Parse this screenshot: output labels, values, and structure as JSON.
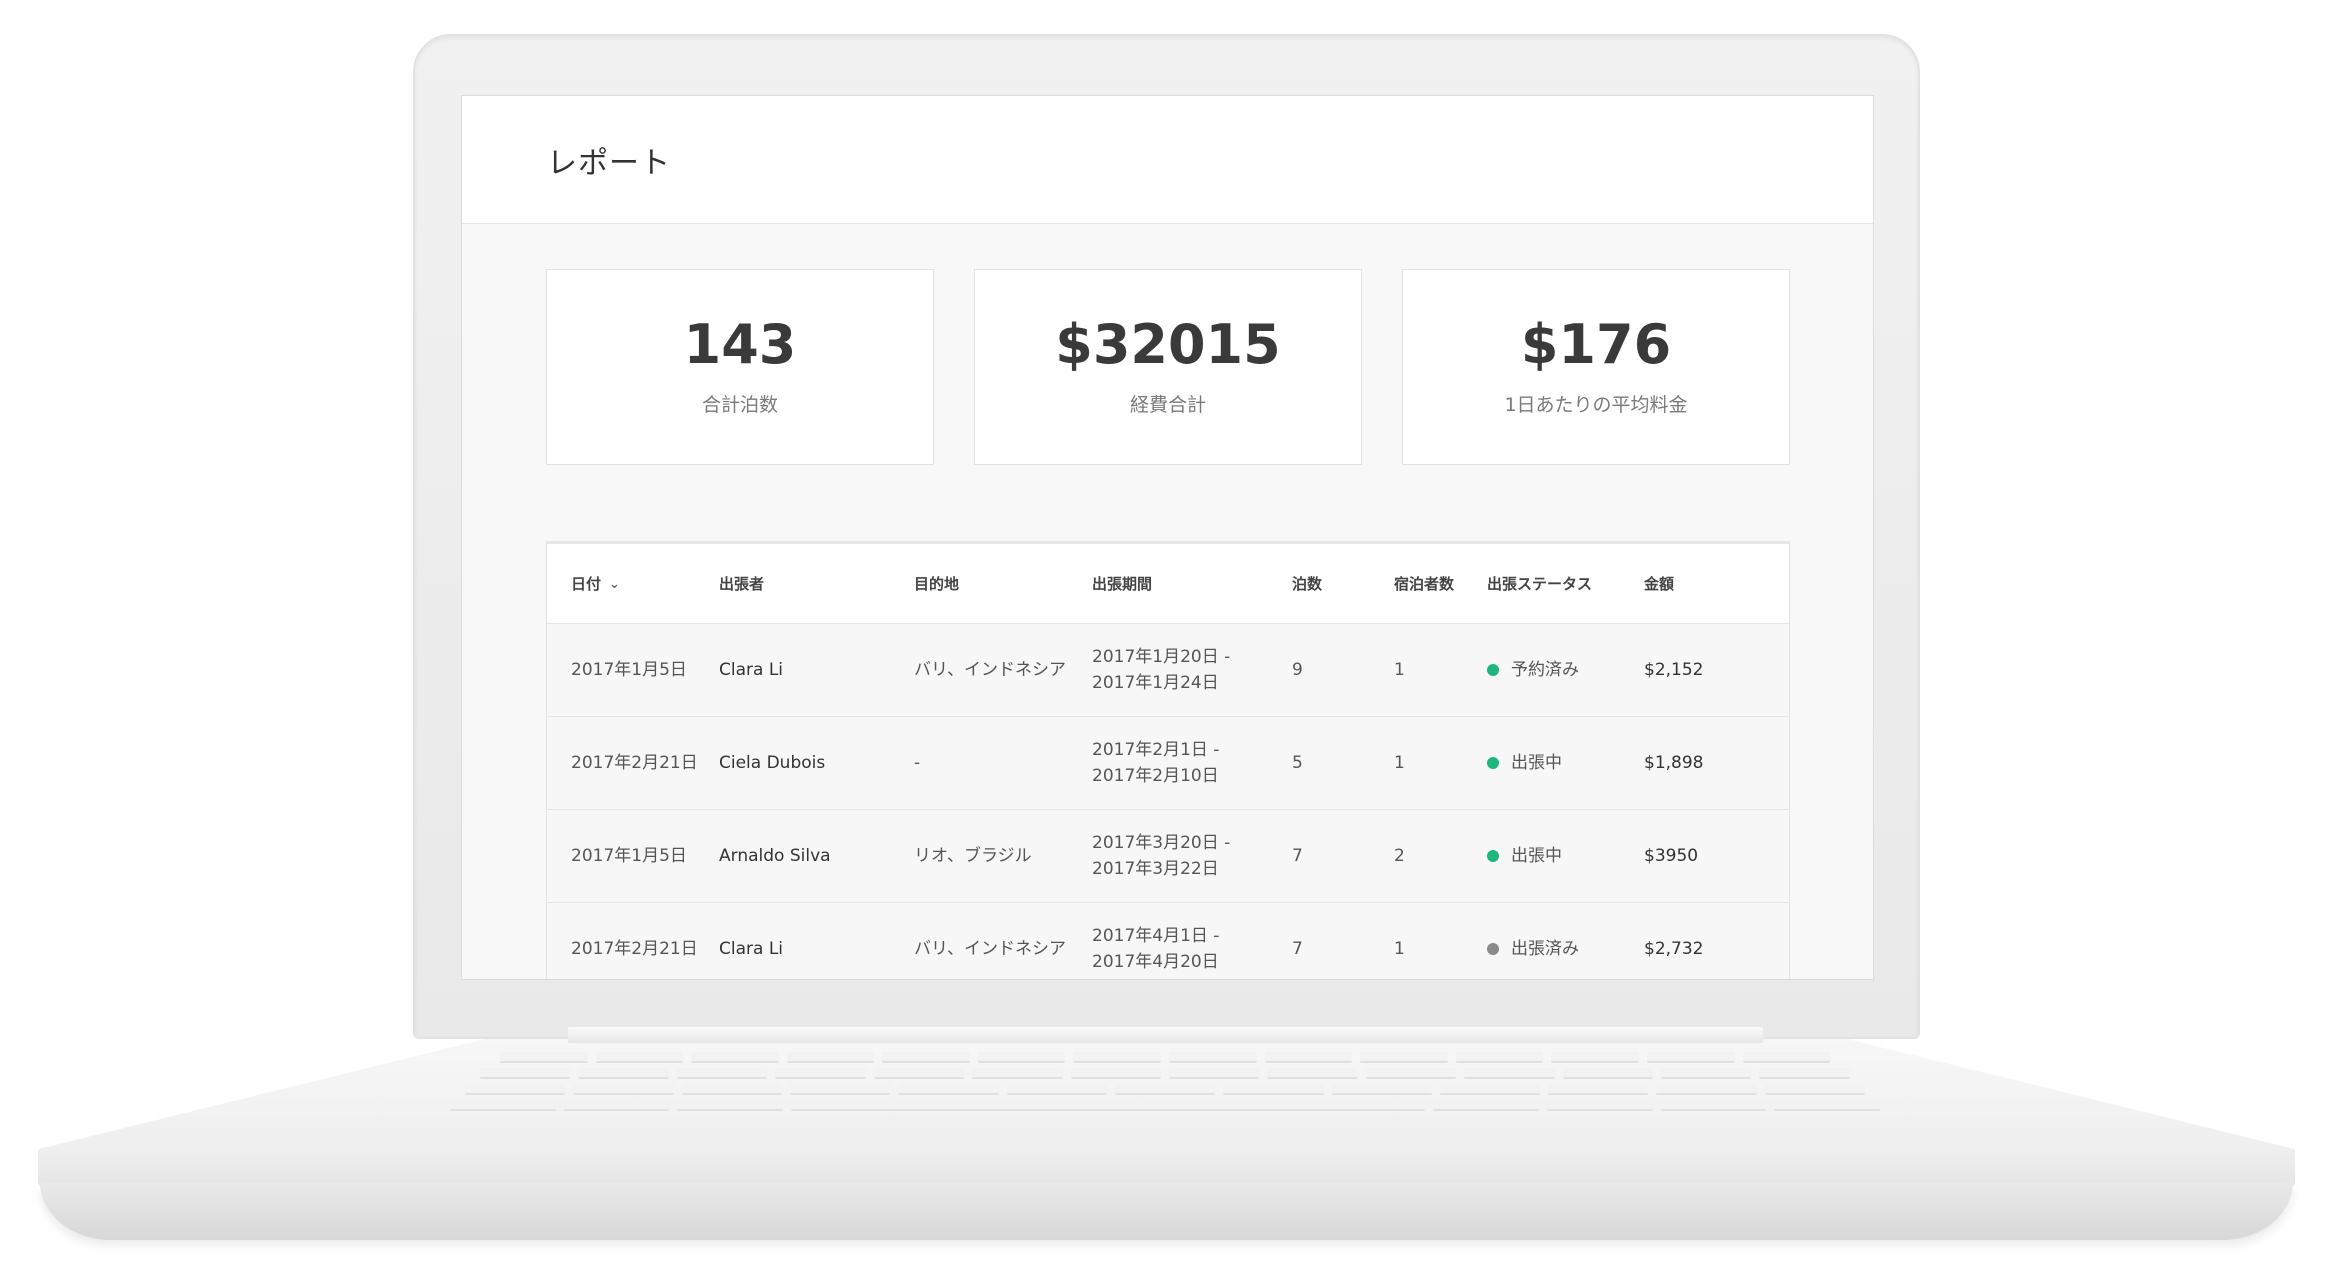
{
  "app": {
    "title": "レポート"
  },
  "stats": [
    {
      "value": "143",
      "label": "合計泊数"
    },
    {
      "value": "$32015",
      "label": "経費合計"
    },
    {
      "value": "$176",
      "label": "1日あたりの平均料金"
    }
  ],
  "table": {
    "headers": {
      "date": "日付",
      "traveler": "出張者",
      "destination": "目的地",
      "period": "出張期間",
      "nights": "泊数",
      "guests": "宿泊者数",
      "status": "出張ステータス",
      "amount": "金額"
    },
    "rows": [
      {
        "date": "2017年1月5日",
        "traveler": "Clara Li",
        "destination": "バリ、インドネシア",
        "period_start": "2017年1月20日 -",
        "period_end": "2017年1月24日",
        "nights": "9",
        "guests": "1",
        "status": "予約済み",
        "status_color": "#1db77d",
        "amount": "$2,152"
      },
      {
        "date": "2017年2月21日",
        "traveler": "Ciela Dubois",
        "destination": "-",
        "period_start": "2017年2月1日 -",
        "period_end": "2017年2月10日",
        "nights": "5",
        "guests": "1",
        "status": "出張中",
        "status_color": "#1db77d",
        "amount": "$1,898"
      },
      {
        "date": "2017年1月5日",
        "traveler": "Arnaldo Silva",
        "destination": "リオ、ブラジル",
        "period_start": "2017年3月20日 -",
        "period_end": "2017年3月22日",
        "nights": "7",
        "guests": "2",
        "status": "出張中",
        "status_color": "#1db77d",
        "amount": "$3950"
      },
      {
        "date": "2017年2月21日",
        "traveler": "Clara Li",
        "destination": "バリ、インドネシア",
        "period_start": "2017年4月1日 -",
        "period_end": "2017年4月20日",
        "nights": "7",
        "guests": "1",
        "status": "出張済み",
        "status_color": "#8a8a8a",
        "amount": "$2,732"
      }
    ]
  },
  "icons": {
    "sort": "chevron-down-icon"
  }
}
